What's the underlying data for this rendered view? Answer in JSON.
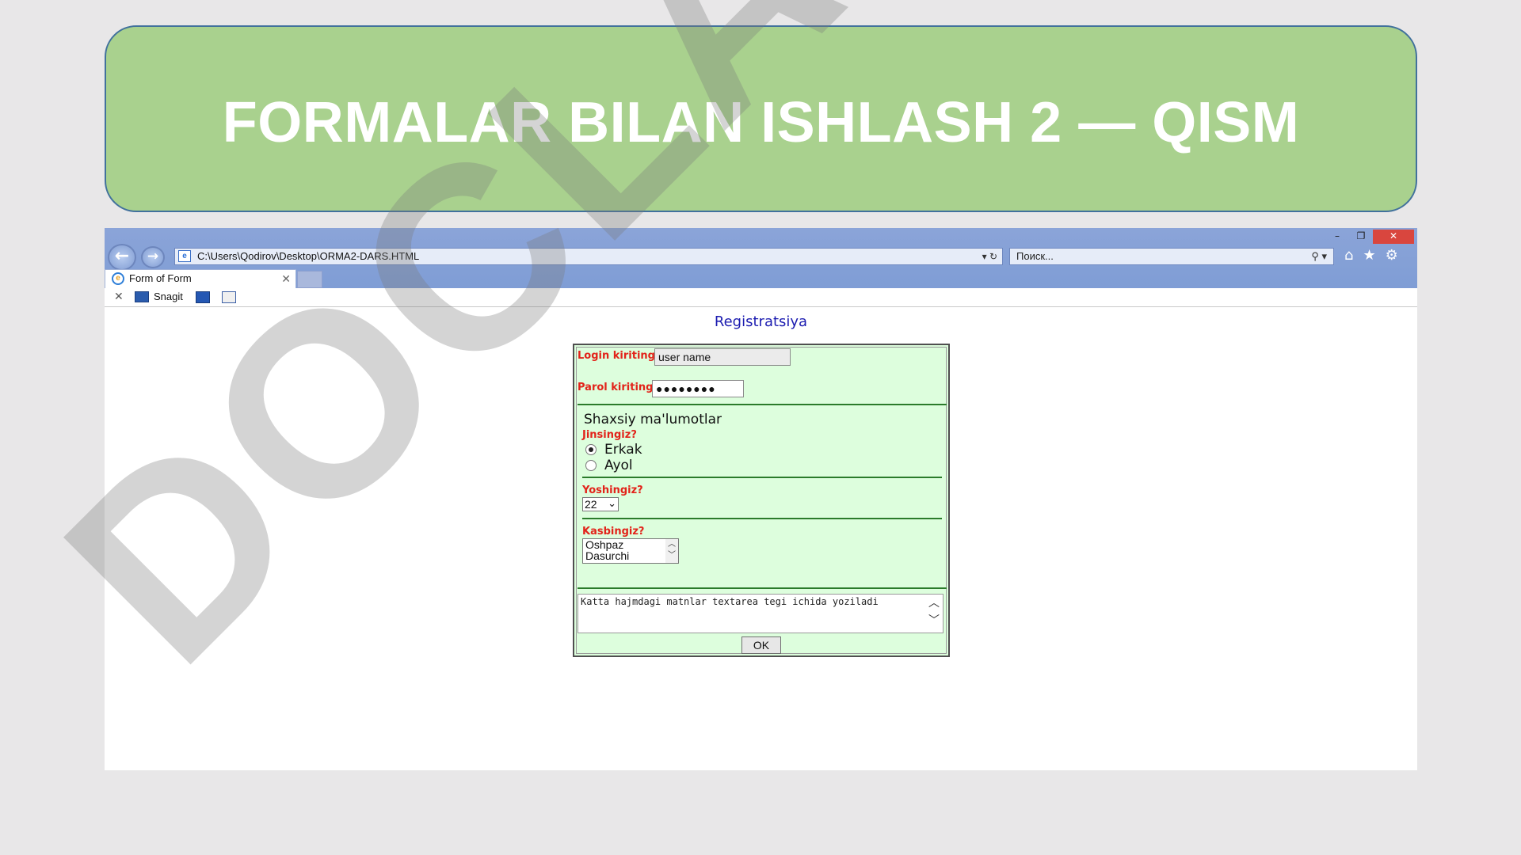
{
  "slide": {
    "title": "FORMALAR BILAN ISHLASH 2 — QISM"
  },
  "browser": {
    "address": "C:\\Users\\Qodirov\\Desktop\\ORMA2-DARS.HTML",
    "search_placeholder": "Поиск...",
    "tab_title": "Form of Form",
    "toolbar_snagit": "Snagit",
    "accent_color": "#7f9dd5",
    "close_color": "#d9463e"
  },
  "page": {
    "heading": "Registratsiya",
    "login_label": "Login kiriting:",
    "login_value": "user name",
    "password_label": "Parol kiriting:",
    "password_value": "●●●●●●●●",
    "fieldset_legend": "Shaxsiy ma'lumotlar",
    "gender_label": "Jinsingiz?",
    "gender_options": [
      "Erkak",
      "Ayol"
    ],
    "gender_selected": "Erkak",
    "age_label": "Yoshingiz?",
    "age_value": "22",
    "job_label": "Kasbingiz?",
    "job_options": [
      "Oshpaz",
      "Dasurchi"
    ],
    "textarea_value": "Katta hajmdagi matnlar textarea tegi ichida yoziladi",
    "ok_label": "OK",
    "form_bg": "#ddfedd",
    "label_color": "#e2231a"
  },
  "watermark": "DOCLAB.UZ"
}
